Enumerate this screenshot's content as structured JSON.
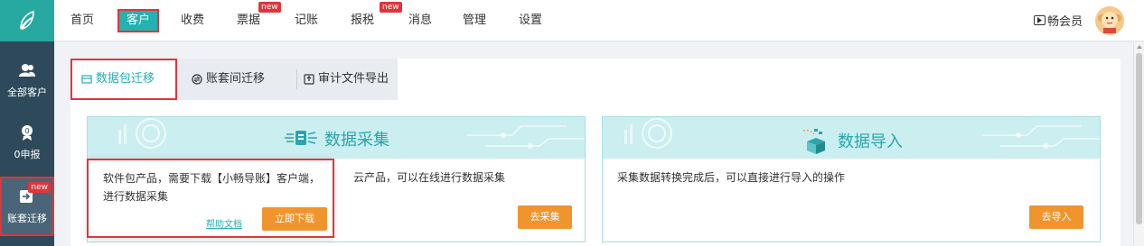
{
  "sidebar": {
    "items": [
      {
        "label": "全部客户",
        "icon": "users-icon"
      },
      {
        "label": "0申报",
        "icon": "zero-declare-icon"
      },
      {
        "label": "账套迁移",
        "icon": "migrate-icon",
        "badge": "new"
      }
    ]
  },
  "nav": {
    "items": [
      {
        "label": "首页"
      },
      {
        "label": "客户"
      },
      {
        "label": "收费"
      },
      {
        "label": "票据",
        "badge": "new"
      },
      {
        "label": "记账"
      },
      {
        "label": "报税",
        "badge": "new"
      },
      {
        "label": "消息"
      },
      {
        "label": "管理"
      },
      {
        "label": "设置"
      }
    ],
    "active": "客户",
    "member_label": "畅会员"
  },
  "tabs": [
    {
      "label": "数据包迁移",
      "icon": "package-icon"
    },
    {
      "label": "账套间迁移",
      "icon": "transfer-icon"
    },
    {
      "label": "审计文件导出",
      "icon": "export-icon"
    }
  ],
  "cards": {
    "collect": {
      "title": "数据采集",
      "desc": "云产品，可以在线进行数据采集",
      "button": "去采集"
    },
    "import": {
      "title": "数据导入",
      "desc": "采集数据转换完成后，可以直接进行导入的操作",
      "button": "去导入"
    }
  },
  "popup": {
    "text": "软件包产品，需要下载【小畅导账】客户端，进行数据采集",
    "help_link": "帮助文档",
    "download_button": "立即下载"
  },
  "colors": {
    "accent": "#23b1b1",
    "sidebar_bg": "#2e4a5a",
    "highlight_red": "#e0353a",
    "orange_button": "#f0952e",
    "card_head_bg": "#cbeef0"
  }
}
